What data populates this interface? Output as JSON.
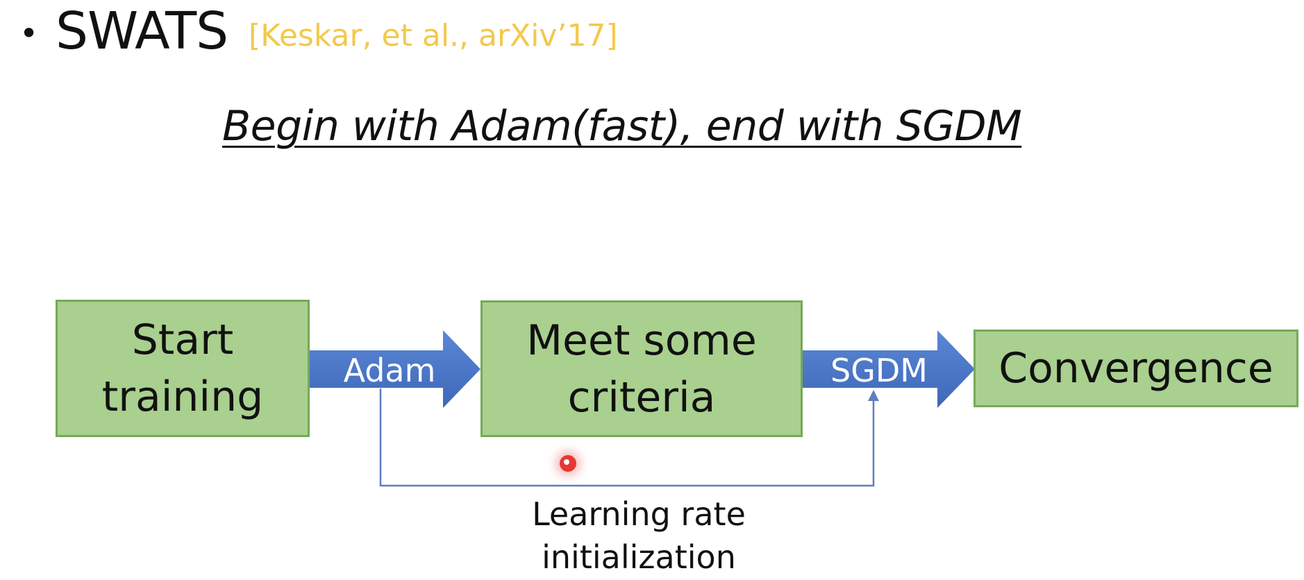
{
  "slide": {
    "bullet": "•",
    "heading": "SWATS",
    "citation": "[Keskar, et al., arXiv’17]",
    "subtitle": "Begin with Adam(fast), end with SGDM"
  },
  "diagram": {
    "nodes": {
      "start": [
        "Start",
        "training"
      ],
      "criteria": [
        "Meet some",
        "criteria"
      ],
      "convergence": "Convergence"
    },
    "edges": {
      "adam": "Adam",
      "sgdm": "SGDM"
    },
    "feedback_label": [
      "Learning rate",
      "initialization"
    ]
  },
  "colors": {
    "box_fill": "#a9d08e",
    "box_border": "#76a957",
    "arrow_fill": "#4472c4",
    "citation": "#f2c94c",
    "feedback_line": "#5b7fbf",
    "pointer": "#e53935"
  },
  "icons": {
    "pointer": "laser-pointer-icon"
  }
}
